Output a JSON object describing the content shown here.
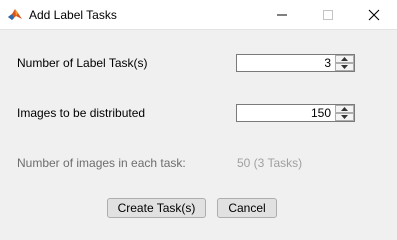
{
  "window": {
    "title": "Add Label Tasks",
    "app_icon": "matlab-icon",
    "controls": [
      "minimize-icon",
      "maximize-icon",
      "close-icon"
    ]
  },
  "form": {
    "num_tasks_label": "Number of Label Task(s)",
    "num_tasks_value": "3",
    "images_label": "Images to be distributed",
    "images_value": "150",
    "per_task_label": "Number of images in each task:",
    "per_task_value": "50 (3 Tasks)"
  },
  "buttons": {
    "create_label": "Create Task(s)",
    "cancel_label": "Cancel"
  },
  "colors": {
    "background": "#f0f0f0",
    "disabled_text": "#a0a0a0"
  }
}
